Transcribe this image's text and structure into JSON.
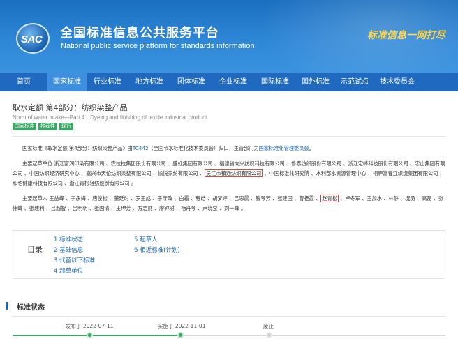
{
  "header": {
    "logo_text": "SAC",
    "title": "全国标准信息公共服务平台",
    "subtitle": "National public service platform  for standards information",
    "slogan": "标准信息一网打尽"
  },
  "nav": {
    "items": [
      {
        "label": "首页"
      },
      {
        "label": "国家标准"
      },
      {
        "label": "行业标准"
      },
      {
        "label": "地方标准"
      },
      {
        "label": "团体标准"
      },
      {
        "label": "企业标准"
      },
      {
        "label": "国际标准"
      },
      {
        "label": "国外标准"
      },
      {
        "label": "示范试点"
      },
      {
        "label": "技术委员会"
      }
    ],
    "active_index": 1
  },
  "standard": {
    "title": "取水定额 第4部分：纺织染整产品",
    "title_en": "Norm of water intake—Part 4：Dyeing and finishing of textile industrial product",
    "tags": [
      "国家标准",
      "推荐性",
      "现行"
    ]
  },
  "para1": {
    "pre": "国家标准《取水定额 第4部分：纺织染整产品》由",
    "tc_link": "TC442",
    "mid": "（全国节水标准化技术委员会）归口，主管部门为",
    "dept_link": "国家标准化管理委员会",
    "post": "。"
  },
  "para2": {
    "pre": "主要起草单位 浙江富润印染有限公司 、农拉拉集团股份有限公司 、盛虹集团有限公司 、福建省向兴纺织科技有限公司 、鲁泰纺织股份有限公司 、浙江宏峰科技股份有限公司 、忠山集团有限公司 、中国纺织经济研究中心 、嘉兴市天伦纺织染整有限公司 、愉悦家纺有限公司 、",
    "boxed": "吴江市镇通纺织有限公司",
    "post": " 、中国标准化研究院 、水利部水资源管理中心 、桐庐富春江织造集团有限公司 、和也健康科技有限公司 、浙江青松轻纺股份有限公司 。"
  },
  "para3": {
    "pre": "主要起草人 王益峰 、于永梅 、唐俊松 、董廷时 、罗玉成 、于守政 、白霜 、程皓 、胡梦婷 、吕思晨 、钱琴芳 、张建国 、曹艳霞 、",
    "boxed": "赵青松",
    "post": " 、卢冬军 、王加水 、林静 、况勇 、高磊 、张伟峰 、张建利 、吕超智 、吕明明 、张国清 、王珅芳 、方志财 、廖钟树 、杨舟琴 、卢晓莹 、刘一峰 。"
  },
  "toc": {
    "label": "目录",
    "col1": [
      "1 标准状态",
      "2 基础信息",
      "3 代替以下标准",
      "4 起草单位"
    ],
    "col2": [
      "5 起草人",
      "6 相近标准(计划)"
    ]
  },
  "status": {
    "title": "标准状态",
    "published": "发布于 2022-07-11",
    "implemented": "实施于 2022-11-01",
    "abolished": "废止"
  }
}
